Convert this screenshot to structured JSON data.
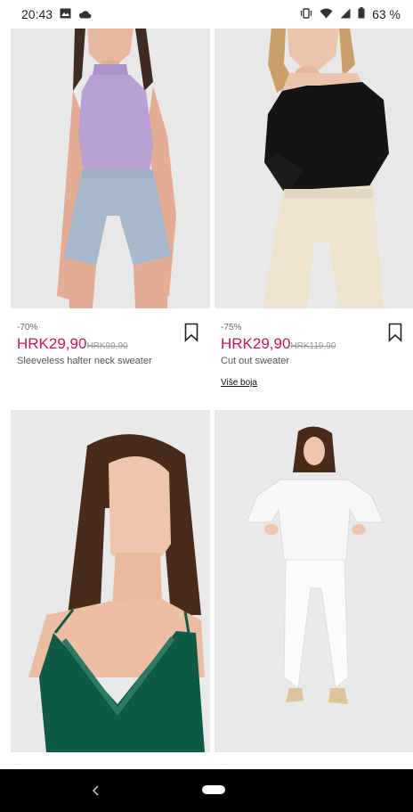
{
  "status_bar": {
    "time": "20:43",
    "battery": "63 %",
    "icons": [
      "gallery-icon",
      "cloud-icon",
      "vibrate-icon",
      "wifi-icon",
      "signal-icon",
      "battery-icon"
    ]
  },
  "products": [
    {
      "discount": "-70%",
      "price": "HRK29,90",
      "old_price": "HRK99,90",
      "name": "Sleeveless halter neck sweater",
      "image": "model-lilac-halter-top-denim-shorts"
    },
    {
      "discount": "-75%",
      "price": "HRK29,90",
      "old_price": "HRK119,90",
      "name": "Cut out sweater",
      "more_colors": "Više boja",
      "image": "model-black-cut-out-sweater-cream-jeans"
    },
    {
      "image": "model-green-lace-camisole"
    },
    {
      "image": "model-white-ruffle-blouse-white-jeans"
    }
  ],
  "colors": {
    "price": "#c2185b",
    "image_bg": "#e7e7e7",
    "nav_bar": "#000000"
  },
  "icons": {
    "bookmark": "bookmark-icon",
    "back": "back-chevron-icon",
    "home": "home-pill-icon"
  }
}
